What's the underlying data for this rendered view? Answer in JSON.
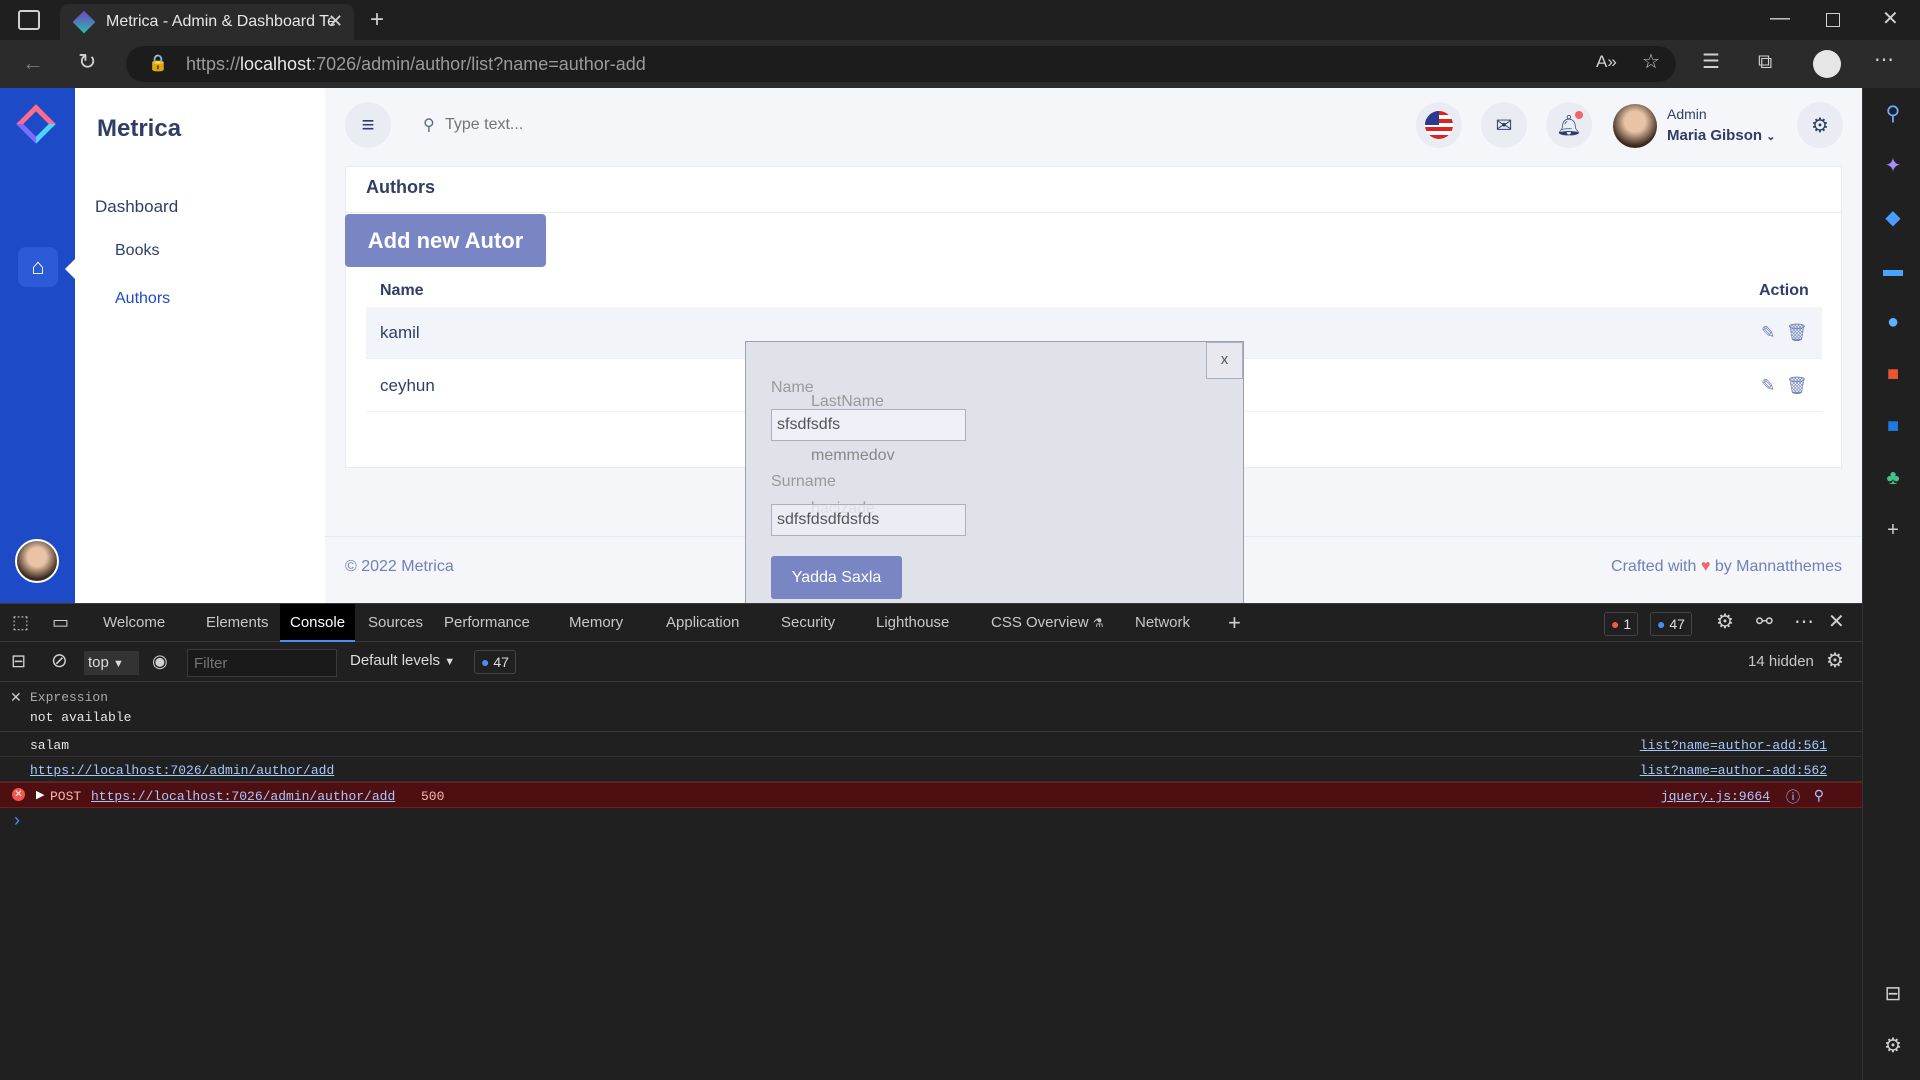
{
  "browser": {
    "tab_title": "Metrica - Admin & Dashboard Te",
    "url_prefix": "https://",
    "url_host": "localhost",
    "url_rest": ":7026/admin/author/list?name=author-add"
  },
  "sidebar": {
    "brand": "Metrica",
    "items": [
      {
        "label": "Dashboard"
      },
      {
        "label": "Books"
      },
      {
        "label": "Authors"
      }
    ]
  },
  "topbar": {
    "search_placeholder": "Type text...",
    "user_role": "Admin",
    "user_name": "Maria Gibson"
  },
  "main": {
    "card_title": "Authors",
    "add_button": "Add new Autor",
    "columns": [
      "Name",
      "Action"
    ],
    "rows": [
      {
        "name": "kamil"
      },
      {
        "name": "ceyhun"
      }
    ]
  },
  "modal": {
    "close": "x",
    "name_label": "Name",
    "name_value": "sfsdfsdfs",
    "lastname_label": "LastName",
    "lastname_ghost": "memmedov",
    "surname_label": "Surname",
    "surname_ghost": "hacizade",
    "surname_value": "sdfsfdsdfdsfds",
    "save_button": "Yadda Saxla"
  },
  "footer": {
    "copyright": "© 2022 Metrica",
    "crafted_prefix": "Crafted with",
    "crafted_suffix": "by Mannatthemes"
  },
  "devtools": {
    "tabs": [
      "Welcome",
      "Elements",
      "Console",
      "Sources",
      "Performance",
      "Memory",
      "Application",
      "Security",
      "Lighthouse",
      "CSS Overview",
      "Network"
    ],
    "active_tab": "Console",
    "error_count": "1",
    "message_count": "47",
    "context": "top",
    "filter_placeholder": "Filter",
    "levels": "Default levels",
    "level_badge": "47",
    "hidden": "14 hidden",
    "expression_label": "Expression",
    "expression_value": "not available",
    "logs": [
      {
        "text": "salam",
        "source": "list?name=author-add:561"
      },
      {
        "text": "https://localhost:7026/admin/author/add",
        "source": "list?name=author-add:562"
      }
    ],
    "error": {
      "method": "POST",
      "url": "https://localhost:7026/admin/author/add",
      "status": "500",
      "source": "jquery.js:9664"
    },
    "prompt": "›"
  },
  "colors": {
    "brand_blue": "#1d4bc7",
    "accent": "#7a86c4",
    "error_bg": "#4e0f13"
  },
  "icons": [
    "sidebar-toggle-icon",
    "back-icon",
    "reload-icon",
    "lock-icon",
    "read-aloud-icon",
    "favorite-add-icon",
    "favorites-icon",
    "collections-icon",
    "profile-icon",
    "more-icon",
    "home-icon",
    "hamburger-icon",
    "search-icon",
    "flag-us-icon",
    "mail-icon",
    "bell-icon",
    "gear-icon",
    "edit-icon",
    "trash-icon",
    "heart-icon"
  ]
}
